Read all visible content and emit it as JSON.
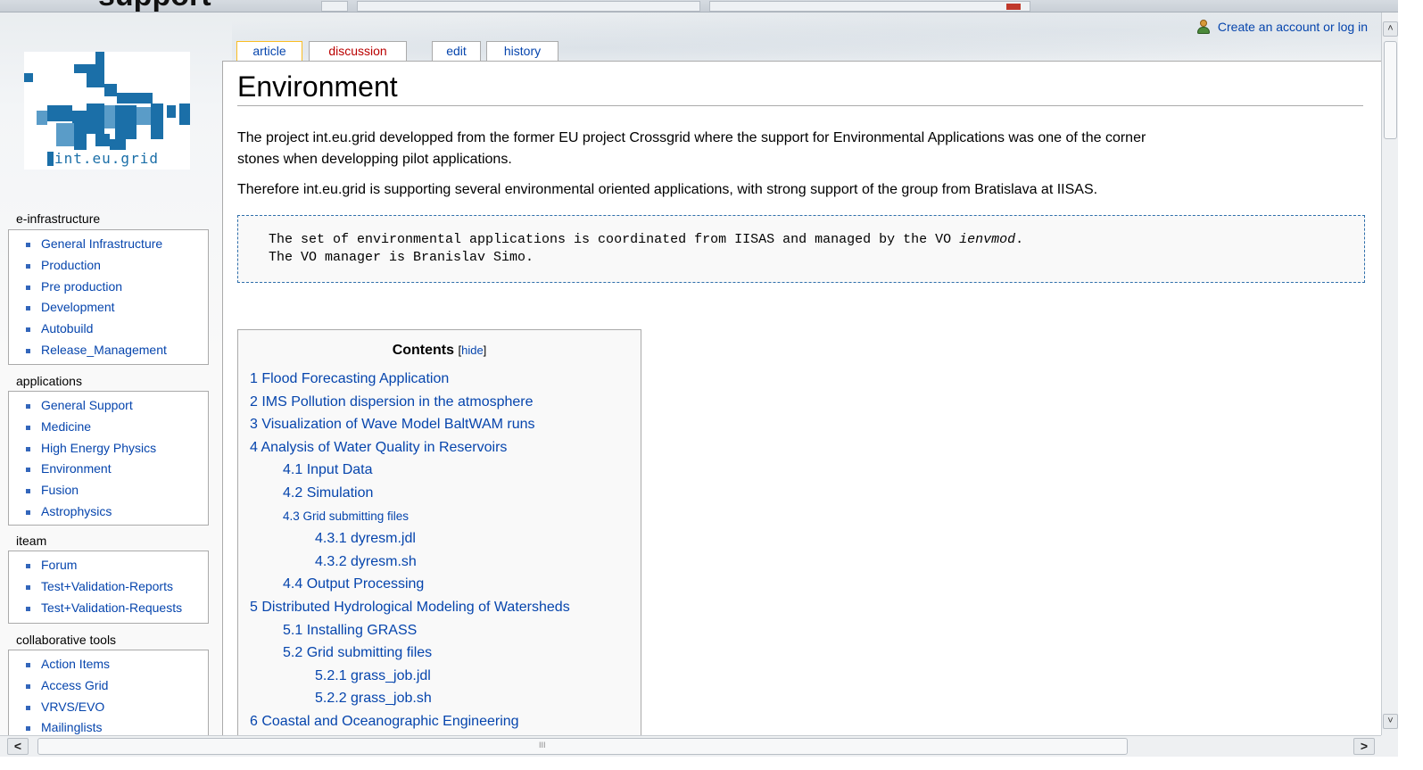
{
  "top_cut_word": "support",
  "personal": {
    "login_label": "Create an account or log in",
    "icon": "user-icon"
  },
  "logo": {
    "text": "int.eu.grid"
  },
  "tabs": [
    {
      "label": "article",
      "selected": true
    },
    {
      "label": "discussion",
      "new": true
    },
    {
      "label": "edit"
    },
    {
      "label": "history"
    }
  ],
  "page": {
    "title": "Environment",
    "para1_line1": "The project int.eu.grid developped from the former EU project Crossgrid where the support for Environmental Applications was one of the corner",
    "para1_line2": "stones when developping pilot applications.",
    "para2": "Therefore int.eu.grid is supporting several environmental oriented applications, with strong support of the group from Bratislava at IISAS.",
    "pre_line1_a": "The set of environmental applications is coordinated from IISAS and managed by the VO ",
    "pre_line1_em": "ienvmod",
    "pre_line1_b": ".",
    "pre_line2": "The VO manager is Branislav Simo."
  },
  "toc": {
    "title": "Contents",
    "hide_open": "[",
    "hide_label": "hide",
    "hide_close": "]",
    "items": [
      {
        "text": "1 Flood Forecasting Application",
        "level": 1
      },
      {
        "text": "2 IMS Pollution dispersion in the atmosphere",
        "level": 1
      },
      {
        "text": "3 Visualization of Wave Model BaltWAM runs",
        "level": 1
      },
      {
        "text": "4 Analysis of Water Quality in Reservoirs",
        "level": 1
      },
      {
        "text": "4.1 Input Data",
        "level": 2
      },
      {
        "text": "4.2 Simulation",
        "level": 2
      },
      {
        "text": "4.3 Grid submitting files",
        "level": 2,
        "small": true
      },
      {
        "text": "4.3.1 dyresm.jdl",
        "level": 3
      },
      {
        "text": "4.3.2 dyresm.sh",
        "level": 3
      },
      {
        "text": "4.4 Output Processing",
        "level": 2
      },
      {
        "text": "5 Distributed Hydrological Modeling of Watersheds",
        "level": 1
      },
      {
        "text": "5.1 Installing GRASS",
        "level": 2
      },
      {
        "text": "5.2 Grid submitting files",
        "level": 2
      },
      {
        "text": "5.2.1 grass_job.jdl",
        "level": 3
      },
      {
        "text": "5.2.2 grass_job.sh",
        "level": 3
      },
      {
        "text": "6 Coastal and Oceanographic Engineering",
        "level": 1
      }
    ]
  },
  "sidebar": {
    "sections": [
      {
        "title": "e-infrastructure",
        "items": [
          "General Infrastructure",
          "Production",
          "Pre production",
          "Development",
          "Autobuild",
          "Release_Management"
        ]
      },
      {
        "title": "applications",
        "items": [
          "General Support",
          "Medicine",
          "High Energy Physics",
          "Environment",
          "Fusion",
          "Astrophysics"
        ]
      },
      {
        "title": "iteam",
        "items": [
          "Forum",
          "Test+Validation-Reports",
          "Test+Validation-Requests"
        ]
      },
      {
        "title": "collaborative tools",
        "items": [
          "Action Items",
          "Access Grid",
          "VRVS/EVO",
          "Mailinglists"
        ]
      }
    ]
  },
  "scrollbars": {
    "left_arrow": "<",
    "right_arrow": ">",
    "up_arrow": "˄",
    "down_arrow": "˅",
    "grip": "III"
  },
  "colors": {
    "link": "#0645ad",
    "new_link": "#ba0000",
    "selected_tab": "#fabd23",
    "pre_border": "#2f6fab"
  }
}
